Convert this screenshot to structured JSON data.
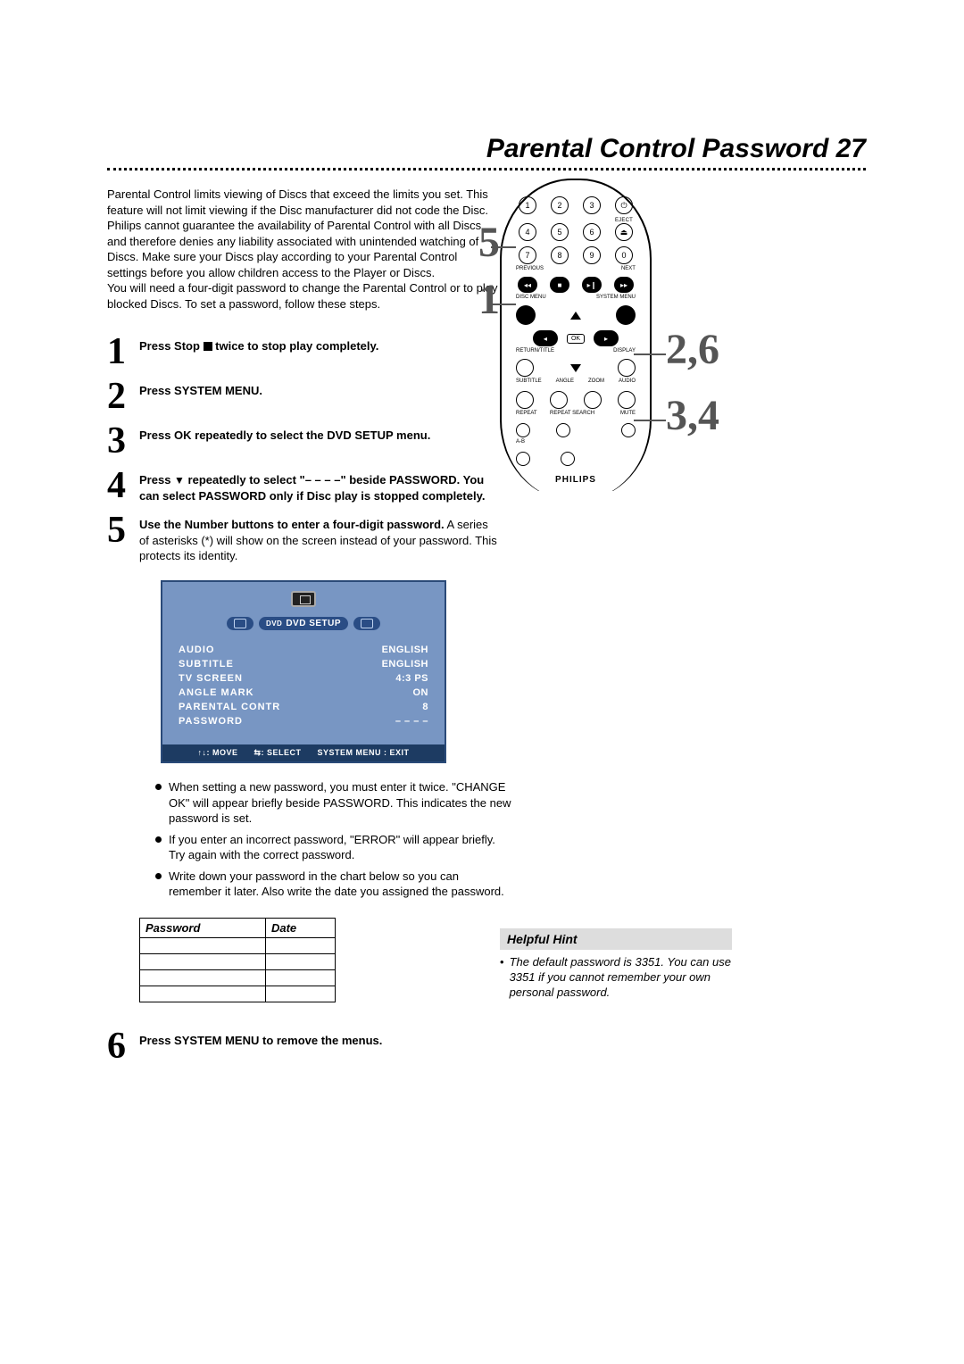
{
  "page": {
    "title": "Parental Control Password",
    "number": "27"
  },
  "intro": {
    "p1": "Parental Control limits viewing of Discs that exceed the limits you set. This feature will not limit viewing if the Disc manufacturer did not code the Disc.  Philips cannot guarantee the availability of Parental Control with all Discs, and therefore denies any liability associated with unintended watching of Discs.  Make sure your Discs play according to your Parental Control settings before you allow children access to the Player or Discs.",
    "p2": "You will need a four-digit password to change the Parental Control or to play blocked Discs. To set a password, follow these steps."
  },
  "steps": {
    "1": {
      "prefix": "Press Stop ",
      "suffix": " twice to stop play completely."
    },
    "2": {
      "bold": "Press SYSTEM MENU."
    },
    "3": {
      "bold": "Press OK repeatedly to select the DVD SETUP menu."
    },
    "4": {
      "prefix": "Press ",
      "mid": " repeatedly to select \"– – – –\" beside PASSWORD. You can select PASSWORD only if Disc play is stopped completely."
    },
    "5": {
      "bold": "Use the Number buttons to enter a four-digit password.",
      "tail": " A series of asterisks (*) will show on the screen instead of your password. This protects its identity."
    },
    "6": {
      "bold": "Press SYSTEM MENU to remove the menus."
    }
  },
  "osd": {
    "tab_setup_prefix": "DVD",
    "tab_setup": "DVD SETUP",
    "rows": [
      {
        "k": "AUDIO",
        "v": "ENGLISH"
      },
      {
        "k": "SUBTITLE",
        "v": "ENGLISH"
      },
      {
        "k": "TV SCREEN",
        "v": "4:3 PS"
      },
      {
        "k": "ANGLE MARK",
        "v": "ON"
      },
      {
        "k": "PARENTAL CONTR",
        "v": "8"
      },
      {
        "k": "PASSWORD",
        "v": "– – – –"
      }
    ],
    "footer": {
      "move": ": MOVE",
      "select": ": SELECT",
      "exit": "SYSTEM MENU : EXIT"
    }
  },
  "bullets": [
    "When setting a new password, you must enter it twice. \"CHANGE OK\" will appear briefly beside PASSWORD. This indicates the new password is set.",
    "If you enter an incorrect password, \"ERROR\" will appear briefly. Try again with the correct password.",
    "Write down your password in the chart below so you can remember it later.  Also write the date you assigned the password."
  ],
  "pwtable": {
    "h1": "Password",
    "h2": "Date"
  },
  "remote": {
    "labels": {
      "eject": "EJECT",
      "previous": "PREVIOUS",
      "next": "NEXT",
      "discmenu": "DISC MENU",
      "systemmenu": "SYSTEM MENU",
      "ok": "OK",
      "returntitle": "RETURN/TITLE",
      "display": "DISPLAY",
      "subtitle": "SUBTITLE",
      "angle": "ANGLE",
      "zoom": "ZOOM",
      "audio": "AUDIO",
      "repeat": "REPEAT",
      "repeatsearch": "REPEAT SEARCH",
      "mute": "MUTE",
      "ab": "A-B"
    },
    "brand": "PHILIPS",
    "callouts": {
      "topleft": "5",
      "midleft": "1",
      "right1": "2,6",
      "right2": "3,4"
    }
  },
  "hint": {
    "title": "Helpful Hint",
    "body": "The default password is 3351. You can use 3351 if you cannot remember your own personal password."
  }
}
